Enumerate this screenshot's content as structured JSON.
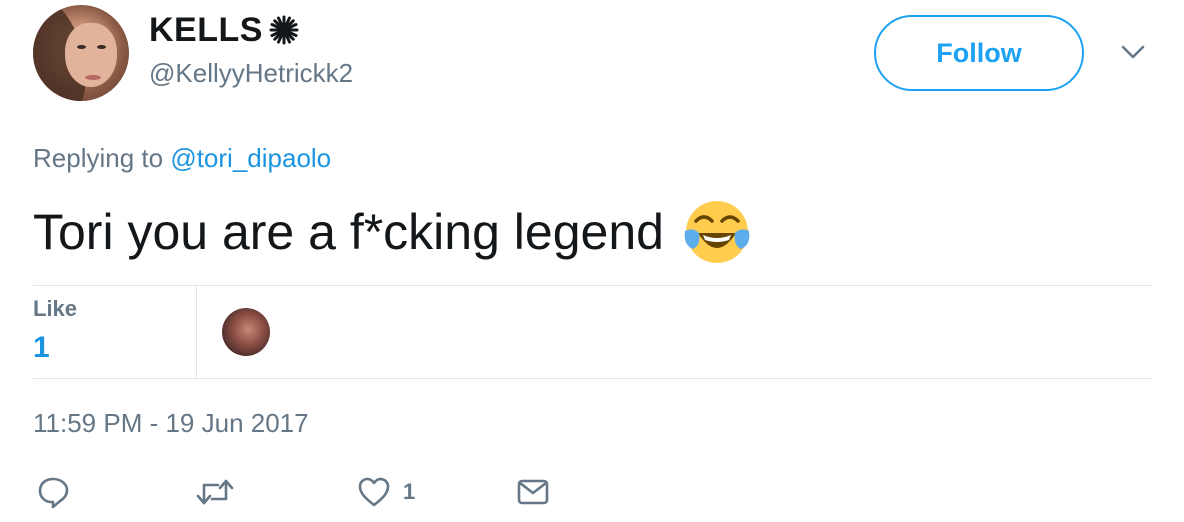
{
  "user": {
    "display_name": "KELLS",
    "handle": "@KellyyHetrickk2"
  },
  "follow_button": {
    "label": "Follow"
  },
  "reply": {
    "prefix": "Replying to",
    "mention": "@tori_dipaolo"
  },
  "tweet": {
    "text": "Tori you are a f*cking legend",
    "emoji": "face-with-tears-of-joy"
  },
  "stats": {
    "like_label": "Like",
    "like_count": "1"
  },
  "timestamp": "11:59 PM - 19 Jun 2017",
  "actions": {
    "like_count": "1",
    "icons": [
      "reply-icon",
      "retweet-icon",
      "heart-icon",
      "message-icon"
    ]
  },
  "colors": {
    "accent": "#1da1f2",
    "link": "#1b95e0",
    "muted": "#657786",
    "divider": "#e1e8ed"
  }
}
